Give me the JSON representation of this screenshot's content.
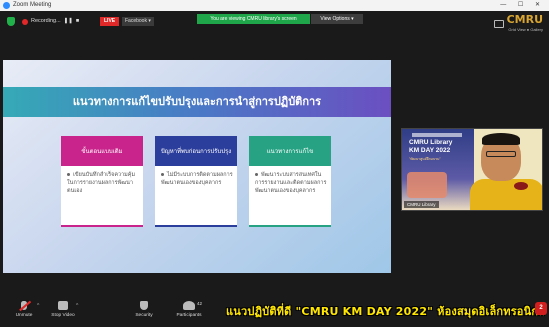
{
  "window": {
    "title": "Zoom Meeting",
    "controls": "— ☐ ✕"
  },
  "topbar": {
    "recording_label": "Recording...",
    "pause_glyph": "❚❚",
    "stop_glyph": "■",
    "live_label": "LIVE",
    "facebook_label": "Facebook ▾",
    "viewing_notice": "You are viewing CMRU library's screen",
    "view_options_label": "View Options ▾",
    "brand_logo": "CMRU",
    "brand_sub": "Grid View ● Gallery"
  },
  "slide": {
    "title": "แนวทางการแก้ไขปรับปรุงและการนำสู่การปฏิบัติการ",
    "columns": [
      {
        "header": "ขั้นตอนแบบเดิม",
        "bullet": "เขียนบันทึกสำเร็จความคุ้มในการรายงานผลการพัฒนาตนเอง"
      },
      {
        "header": "ปัญหาที่พบก่อนการปรับปรุง",
        "bullet": "ไม่มีระบบการติดตามผลการพัฒนาตนเองของบุคลากร"
      },
      {
        "header": "แนวทางการแก้ไข",
        "bullet": "พัฒนาระบบสารสนเทศในการรายงานและติดตามผลการพัฒนาตนเองของบุคลากร"
      }
    ],
    "colors": {
      "col1": "#c9248c",
      "col2": "#2c3e9b",
      "col3": "#27a384"
    }
  },
  "video": {
    "poster_line1": "CMRU Library",
    "poster_line2": "KM DAY 2022",
    "poster_sub": "\"พัฒนาศูนย์ฝึกอบรม\"",
    "participant_name": "CMRU Library"
  },
  "toolbar": {
    "items": [
      {
        "label": "Unmute",
        "icon": "microphone-muted-icon"
      },
      {
        "label": "Stop Video",
        "icon": "video-camera-icon"
      },
      {
        "label": "Security",
        "icon": "shield-icon"
      },
      {
        "label": "Participants",
        "icon": "participants-icon"
      }
    ],
    "participant_count": "42",
    "caption": "แนวปฏิบัติที่ดี \"CMRU KM DAY 2022\" ห้องสมุดอิเล็กทรอนิกส์",
    "end_badge": "2"
  }
}
